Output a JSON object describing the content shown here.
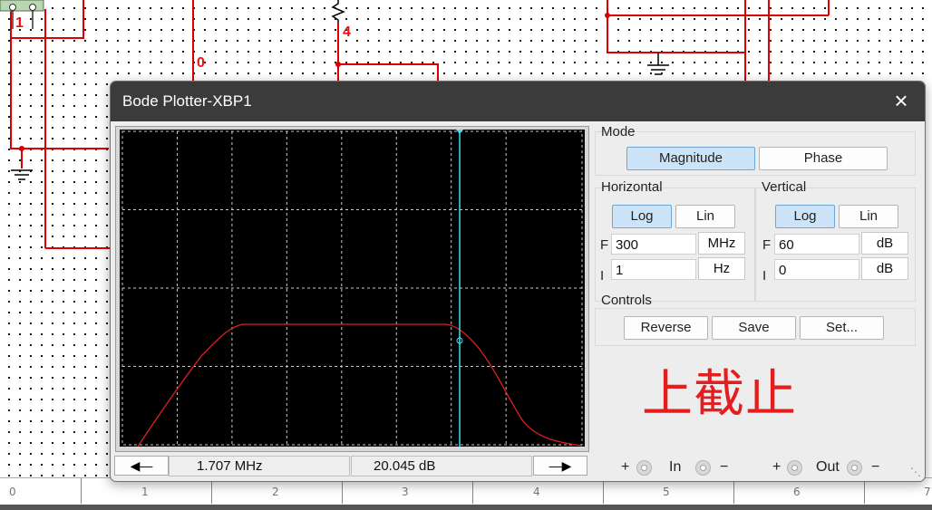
{
  "schematic": {
    "net_labels": [
      "1",
      "0",
      "4"
    ]
  },
  "ruler": {
    "ticks": [
      "0",
      "1",
      "2",
      "3",
      "4",
      "5",
      "6",
      "7"
    ]
  },
  "dialog": {
    "title": "Bode Plotter-XBP1",
    "close_icon": "×",
    "plot": {
      "background": "#000000",
      "grid_color": "#c8c8c8",
      "curve_color": "#e02020",
      "cursor_color": "#40e0f0",
      "cursor_frequency": "1.707 MHz",
      "cursor_value": "20.045 dB"
    },
    "nav": {
      "left_icon": "arrow-left-icon",
      "right_icon": "arrow-right-icon",
      "left_glyph": "🡄",
      "right_glyph": "🡆"
    },
    "mode": {
      "label": "Mode",
      "magnitude": "Magnitude",
      "phase": "Phase",
      "selected": "Magnitude"
    },
    "horizontal": {
      "label": "Horizontal",
      "log": "Log",
      "lin": "Lin",
      "selected": "Log",
      "f_letter": "F",
      "f_value": "300",
      "f_unit": "MHz",
      "i_letter": "I",
      "i_value": "1",
      "i_unit": "Hz"
    },
    "vertical": {
      "label": "Vertical",
      "log": "Log",
      "lin": "Lin",
      "selected": "Log",
      "f_letter": "F",
      "f_value": "60",
      "f_unit": "dB",
      "i_letter": "I",
      "i_value": "0",
      "i_unit": "dB"
    },
    "controls": {
      "label": "Controls",
      "reverse": "Reverse",
      "save": "Save",
      "set": "Set..."
    },
    "annotation": "上截止",
    "terminals": {
      "plus": "+",
      "minus": "−",
      "in_label": "In",
      "out_label": "Out"
    }
  }
}
